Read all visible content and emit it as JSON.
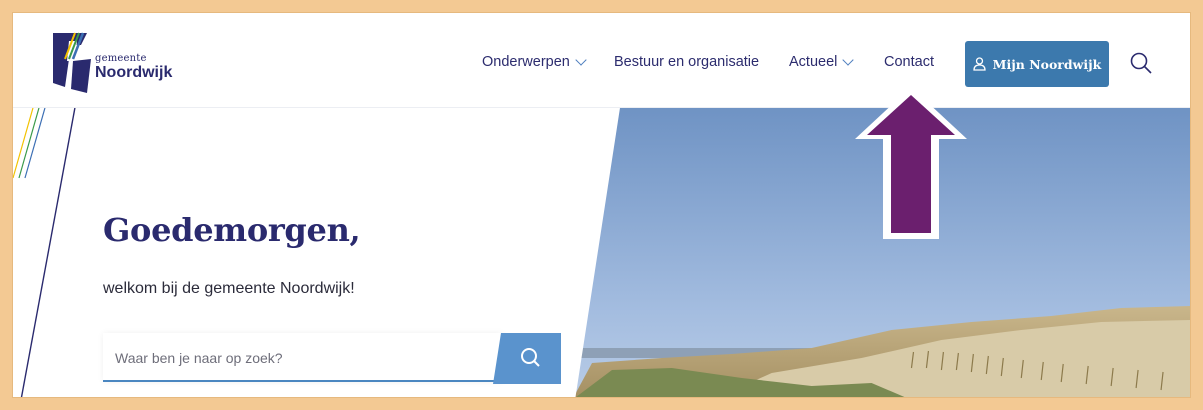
{
  "logo": {
    "small_text": "gemeente",
    "big_text": "Noordwijk",
    "colors": {
      "navy": "#2a2a6e",
      "blue": "#3c6fb4",
      "yellow": "#f2c200",
      "green": "#3a9a4a"
    }
  },
  "nav": {
    "items": [
      {
        "label": "Onderwerpen",
        "has_dropdown": true
      },
      {
        "label": "Bestuur en organisatie",
        "has_dropdown": false
      },
      {
        "label": "Actueel",
        "has_dropdown": true
      },
      {
        "label": "Contact",
        "has_dropdown": false
      }
    ],
    "account_button": {
      "label": "Mijn Noordwijk",
      "icon": "user-icon"
    },
    "search_icon": "search-icon"
  },
  "hero": {
    "greeting": "Goedemorgen,",
    "welcome": "welkom bij de gemeente Noordwijk!",
    "search": {
      "placeholder": "Waar ben je naar op zoek?",
      "icon": "search-icon"
    }
  },
  "annotation": {
    "type": "arrow",
    "direction": "up",
    "color": "#6b1f6e"
  },
  "colors": {
    "frame_background": "#f3c993",
    "primary_navy": "#2a2a6e",
    "button_blue": "#3c79ad",
    "search_blue": "#5a93cd"
  }
}
